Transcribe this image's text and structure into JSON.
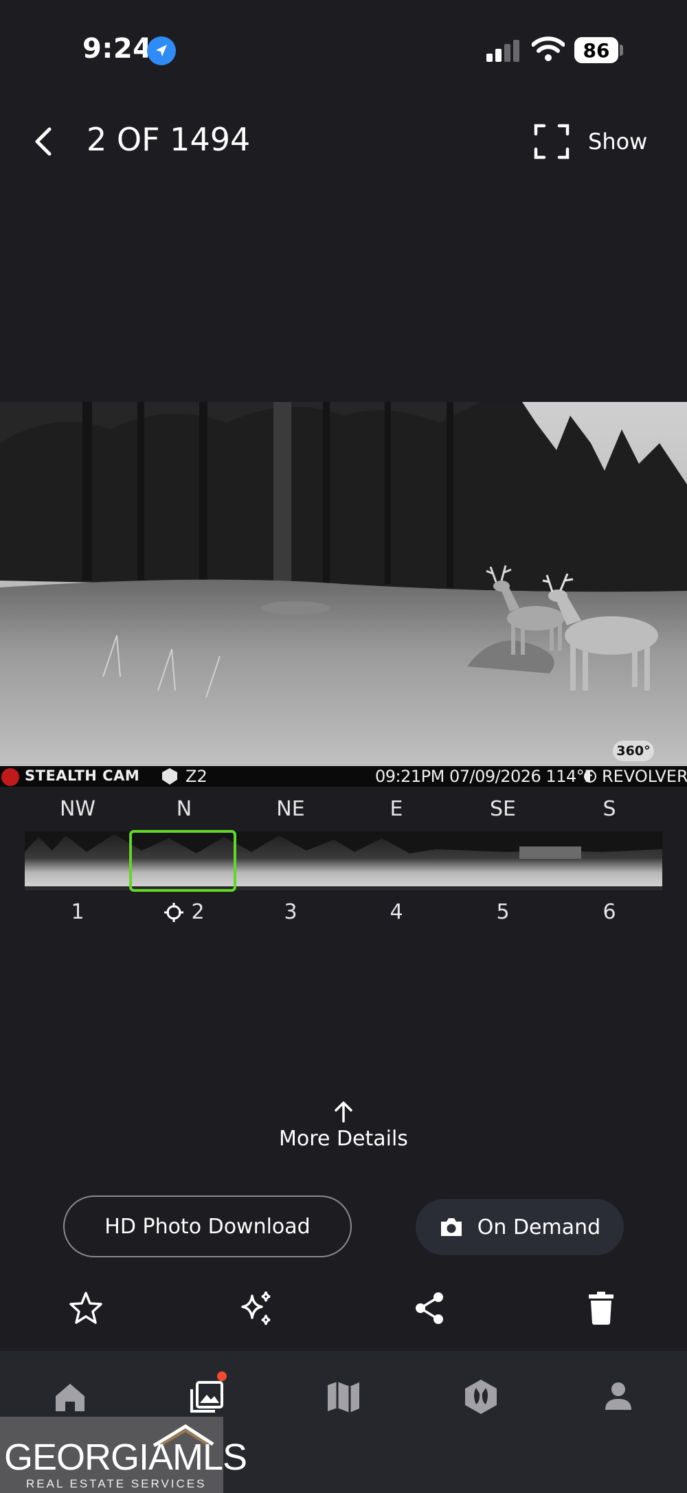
{
  "status_bar": {
    "time": "9:24",
    "battery": "86",
    "icons": [
      "location-arrow-icon",
      "cellular-signal-icon",
      "wifi-icon",
      "battery-icon"
    ]
  },
  "header": {
    "counter": "2 OF 1494",
    "show_label": "Show",
    "icons": [
      "chevron-left-icon",
      "fullscreen-icon"
    ]
  },
  "photo": {
    "badge": "360°",
    "camera_brand": "STEALTH CAM",
    "camera_model": "Z2",
    "timestamp": "09:21PM 07/09/2026 114°F",
    "mode": "REVOLVER"
  },
  "directions": [
    "NW",
    "N",
    "NE",
    "E",
    "SE",
    "S"
  ],
  "frames": [
    "1",
    "2",
    "3",
    "4",
    "5",
    "6"
  ],
  "selected_frame": "2",
  "more_details": "More Details",
  "actions": {
    "hd_download": "HD Photo Download",
    "on_demand": "On Demand"
  },
  "toolbar_icons": [
    "star-icon",
    "sparkles-icon",
    "share-icon",
    "trash-icon"
  ],
  "bottom_nav": [
    "home-icon",
    "gallery-icon",
    "map-icon",
    "hoofprint-icon",
    "profile-icon"
  ],
  "watermark": {
    "title": "GEORGIAMLS",
    "subtitle": "REAL ESTATE SERVICES"
  },
  "colors": {
    "background": "#1c1c21",
    "selection": "#62d629",
    "location": "#2f8cf7",
    "notification": "#f04b2e"
  }
}
